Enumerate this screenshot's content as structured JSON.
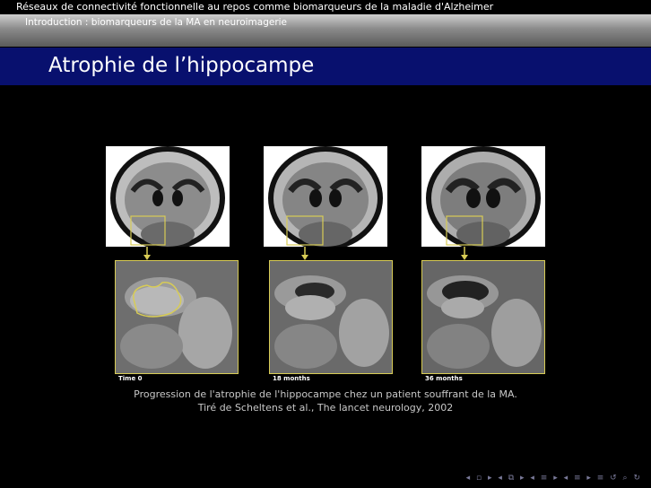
{
  "header": {
    "presentation_title": "Réseaux de connectivité fonctionnelle au repos comme biomarqueurs de la maladie d'Alzheimer",
    "section": "Introduction : biomarqueurs de la MA en neuroimagerie"
  },
  "slide": {
    "title": "Atrophie de l’hippocampe"
  },
  "figure": {
    "labels": [
      "Time 0",
      "18 months",
      "36 months"
    ]
  },
  "caption": {
    "line1": "Progression de l'atrophie de l'hippocampe chez un patient souffrant de la MA.",
    "line2": "Tiré de Scheltens et al., The lancet neurology, 2002"
  },
  "nav": {
    "symbols": "◂ ▫ ▸ ◂ ⧉ ▸ ◂ ≡ ▸ ◂ ≡ ▸ ≡ ↺ ⌕ ↻"
  }
}
